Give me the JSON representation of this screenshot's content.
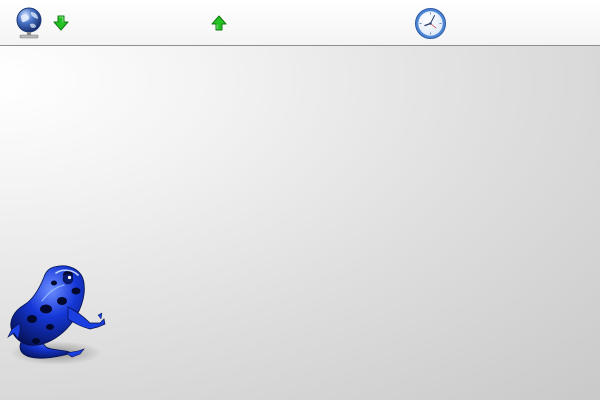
{
  "panel": {
    "tray_icons": [
      {
        "name": "network-globe-icon",
        "interactable": true
      },
      {
        "name": "download-arrow-icon",
        "interactable": false
      },
      {
        "name": "upload-arrow-icon",
        "interactable": false
      },
      {
        "name": "clock-icon",
        "interactable": true
      }
    ]
  },
  "desktop": {
    "wallpaper_icon": "blue-poison-dart-frog-icon"
  },
  "colors": {
    "panel_bg": "#f6f6f6",
    "panel_border": "#8e8e8e",
    "arrow_green": "#22c322",
    "globe_blue": "#2c55a8",
    "frog_blue": "#1638d8",
    "clock_blue": "#4d86d6"
  }
}
